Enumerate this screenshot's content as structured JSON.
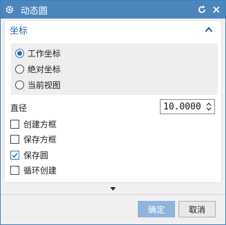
{
  "window": {
    "title": "动态圆",
    "icons": [
      "gear-icon",
      "reset-icon",
      "close-icon"
    ]
  },
  "section": {
    "title": "坐标",
    "collapse_icon": "chevron-up-icon",
    "options": [
      {
        "label": "工作坐标",
        "checked": true
      },
      {
        "label": "绝对坐标",
        "checked": false
      },
      {
        "label": "当前视图",
        "checked": false
      }
    ]
  },
  "diameter": {
    "label": "直径",
    "value": "10.0000"
  },
  "checkboxes": [
    {
      "label": "创建方框",
      "checked": false
    },
    {
      "label": "保存方框",
      "checked": false
    },
    {
      "label": "保存圆",
      "checked": true
    },
    {
      "label": "循环创建",
      "checked": false
    }
  ],
  "footer": {
    "ok_label": "确定",
    "cancel_label": "取消"
  },
  "colors": {
    "titlebar": "#4c86bd",
    "accent": "#1f5fa6",
    "ok_button": "#8fb6da"
  }
}
